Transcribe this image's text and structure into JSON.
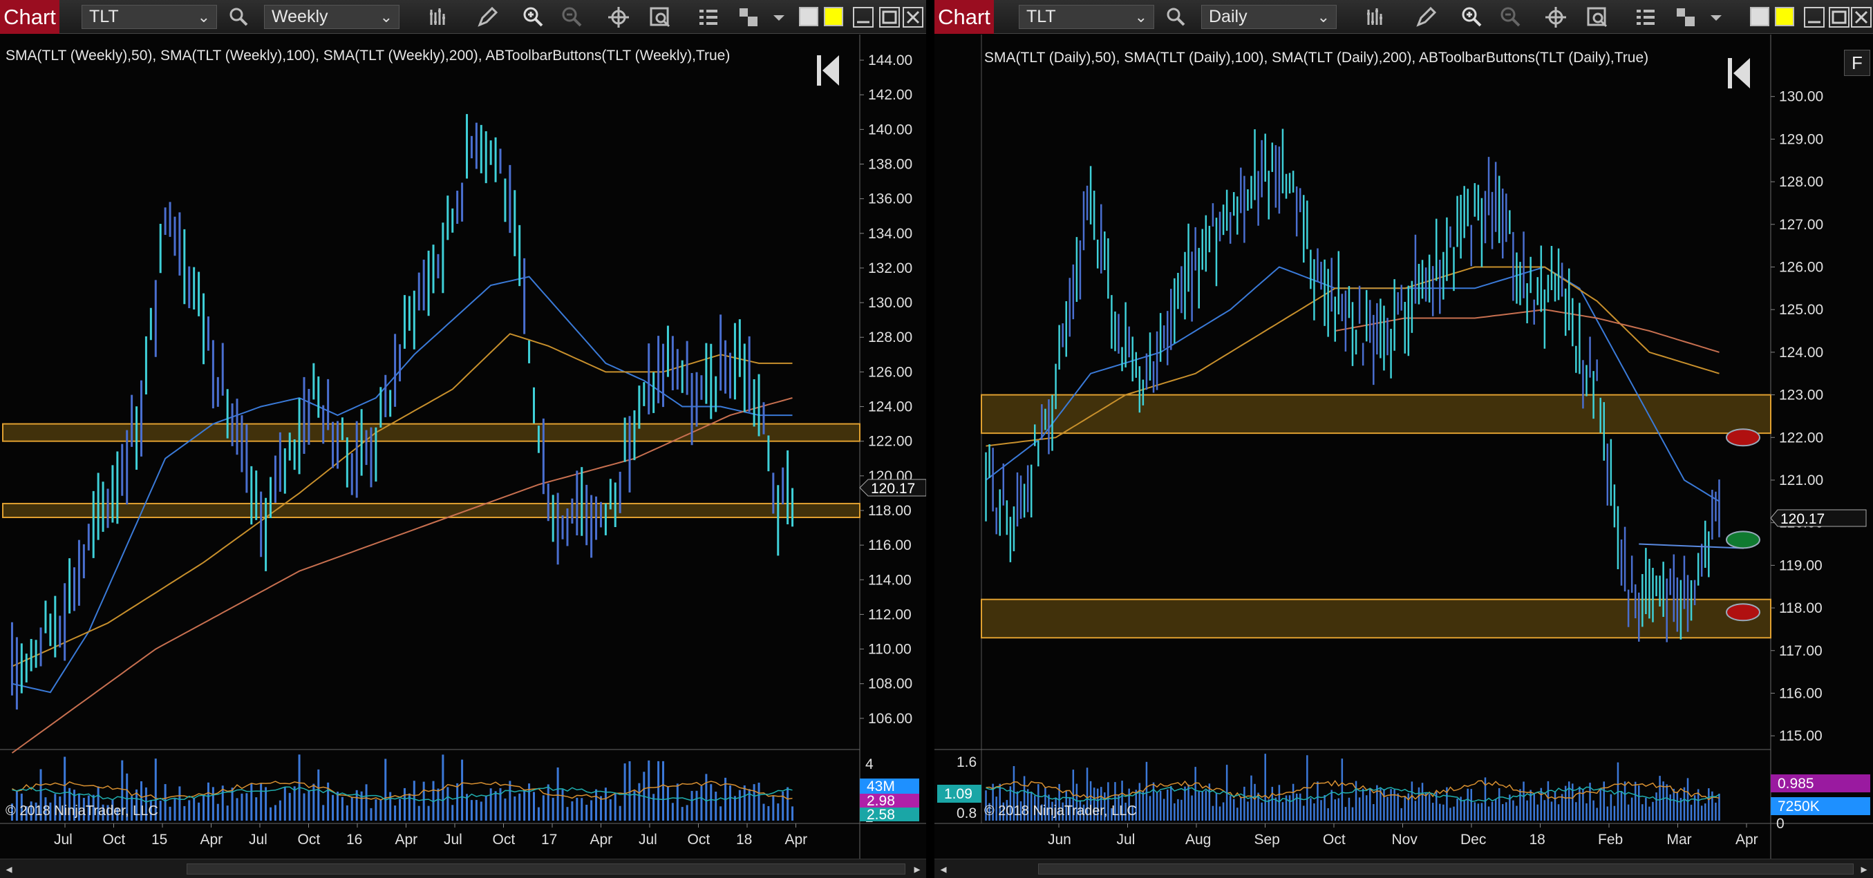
{
  "left": {
    "toolbar": {
      "chart_label": "Chart",
      "instrument": "TLT",
      "interval": "Weekly"
    },
    "indicator_text": "SMA(TLT (Weekly),50), SMA(TLT (Weekly),100), SMA(TLT (Weekly),200), ABToolbarButtons(TLT (Weekly),True)",
    "copyright": "© 2018 NinjaTrader, LLC",
    "last_price": "120.17",
    "volume_labels": [
      "4",
      "2"
    ],
    "volume_badges": [
      {
        "text": "43M",
        "color": "#1e90ff"
      },
      {
        "text": "2.98",
        "color": "#b01fa8"
      },
      {
        "text": "2.58",
        "color": "#1aa6a6"
      }
    ],
    "chart_data": {
      "type": "line",
      "title": "",
      "ylim": [
        104,
        145
      ],
      "yticks": [
        "144.00",
        "142.00",
        "140.00",
        "138.00",
        "136.00",
        "134.00",
        "132.00",
        "130.00",
        "128.00",
        "126.00",
        "124.00",
        "122.00",
        "120.00",
        "118.00",
        "116.00",
        "114.00",
        "112.00",
        "110.00",
        "108.00",
        "106.00"
      ],
      "xticks": [
        "Jul",
        "Oct",
        "15",
        "Apr",
        "Jul",
        "Oct",
        "16",
        "Apr",
        "Jul",
        "Oct",
        "17",
        "Apr",
        "Jul",
        "Oct",
        "18",
        "Apr"
      ],
      "price_series": {
        "name": "TLT Weekly",
        "color": "#3fd0d8",
        "anchors": [
          [
            0,
            108.5
          ],
          [
            10,
            112
          ],
          [
            16,
            116
          ],
          [
            22,
            120
          ],
          [
            27,
            124
          ],
          [
            33,
            136
          ],
          [
            38,
            131
          ],
          [
            42,
            127
          ],
          [
            48,
            121
          ],
          [
            52,
            117
          ],
          [
            56,
            120
          ],
          [
            63,
            125
          ],
          [
            70,
            121
          ],
          [
            76,
            122
          ],
          [
            84,
            130
          ],
          [
            90,
            133
          ],
          [
            97,
            140
          ],
          [
            102,
            138
          ],
          [
            106,
            132
          ],
          [
            110,
            122
          ],
          [
            114,
            117
          ],
          [
            118,
            119
          ],
          [
            123,
            117
          ],
          [
            128,
            121
          ],
          [
            133,
            125
          ],
          [
            138,
            127
          ],
          [
            143,
            124
          ],
          [
            148,
            126
          ],
          [
            152,
            127
          ],
          [
            156,
            124
          ],
          [
            160,
            118
          ],
          [
            163,
            119
          ]
        ]
      },
      "sma_series": [
        {
          "period": 50,
          "color": "#3a7ad8",
          "anchors": [
            [
              0,
              108
            ],
            [
              8,
              107.5
            ],
            [
              16,
              111
            ],
            [
              24,
              116
            ],
            [
              32,
              121
            ],
            [
              42,
              123
            ],
            [
              52,
              124
            ],
            [
              60,
              124.5
            ],
            [
              68,
              123.5
            ],
            [
              76,
              124.5
            ],
            [
              84,
              127
            ],
            [
              92,
              129
            ],
            [
              100,
              131
            ],
            [
              108,
              131.5
            ],
            [
              116,
              129
            ],
            [
              124,
              126.5
            ],
            [
              132,
              125.5
            ],
            [
              140,
              124
            ],
            [
              148,
              124
            ],
            [
              156,
              123.5
            ],
            [
              163,
              123.5
            ]
          ]
        },
        {
          "period": 100,
          "color": "#c8902c",
          "anchors": [
            [
              0,
              109
            ],
            [
              20,
              111.5
            ],
            [
              40,
              115
            ],
            [
              60,
              119
            ],
            [
              76,
              122.5
            ],
            [
              92,
              125
            ],
            [
              104,
              128.2
            ],
            [
              112,
              127.5
            ],
            [
              124,
              126
            ],
            [
              136,
              126
            ],
            [
              148,
              127
            ],
            [
              156,
              126.5
            ],
            [
              163,
              126.5
            ]
          ]
        },
        {
          "period": 200,
          "color": "#c87050",
          "anchors": [
            [
              0,
              104
            ],
            [
              30,
              110
            ],
            [
              60,
              114.5
            ],
            [
              90,
              117.5
            ],
            [
              110,
              119.5
            ],
            [
              130,
              121
            ],
            [
              150,
              123.5
            ],
            [
              163,
              124.5
            ]
          ]
        }
      ],
      "zones": [
        [
          122,
          123
        ],
        [
          117.6,
          118.4
        ]
      ],
      "volume_series": {
        "color": "#3b78d8",
        "count": 164
      }
    }
  },
  "right": {
    "toolbar": {
      "chart_label": "Chart",
      "instrument": "TLT",
      "interval": "Daily"
    },
    "indicator_text": "SMA(TLT (Daily),50), SMA(TLT (Daily),100), SMA(TLT (Daily),200), ABToolbarButtons(TLT (Daily),True)",
    "copyright": "© 2018 NinjaTrader, LLC",
    "last_price": "120.17",
    "f_button": "F",
    "volume_labels": [
      "1.6",
      "0.8",
      "0"
    ],
    "volume_left_badge": "1.09",
    "volume_badges": [
      {
        "text": "0.985",
        "color": "#9a1aa0"
      },
      {
        "text": "7250K",
        "color": "#1e90ff"
      }
    ],
    "chart_data": {
      "type": "line",
      "title": "",
      "ylim": [
        114.5,
        131
      ],
      "yticks": [
        "130.00",
        "129.00",
        "128.00",
        "127.00",
        "126.00",
        "125.00",
        "124.00",
        "123.00",
        "122.00",
        "121.00",
        "120.00",
        "119.00",
        "118.00",
        "117.00",
        "116.00",
        "115.00"
      ],
      "xticks": [
        "Jun",
        "Jul",
        "Aug",
        "Sep",
        "Oct",
        "Nov",
        "Dec",
        "18",
        "Feb",
        "Mar",
        "Apr"
      ],
      "price_series": {
        "name": "TLT Daily",
        "color": "#3fd0d8",
        "anchors": [
          [
            0,
            121
          ],
          [
            8,
            120
          ],
          [
            16,
            122
          ],
          [
            24,
            124.5
          ],
          [
            30,
            127.5
          ],
          [
            36,
            125
          ],
          [
            44,
            123
          ],
          [
            52,
            124.5
          ],
          [
            60,
            126
          ],
          [
            70,
            127.5
          ],
          [
            78,
            128
          ],
          [
            84,
            128.5
          ],
          [
            90,
            127
          ],
          [
            96,
            125.5
          ],
          [
            104,
            125
          ],
          [
            112,
            124
          ],
          [
            116,
            124.5
          ],
          [
            122,
            125.5
          ],
          [
            130,
            126
          ],
          [
            138,
            127
          ],
          [
            146,
            127.5
          ],
          [
            152,
            126
          ],
          [
            158,
            125
          ],
          [
            164,
            126
          ],
          [
            170,
            124
          ],
          [
            176,
            123
          ],
          [
            180,
            120
          ],
          [
            184,
            118.5
          ],
          [
            190,
            118
          ],
          [
            196,
            118.5
          ],
          [
            202,
            118.5
          ],
          [
            206,
            119.5
          ],
          [
            210,
            120.2
          ]
        ]
      },
      "sma_series": [
        {
          "period": 50,
          "color": "#3a7ad8",
          "anchors": [
            [
              0,
              121
            ],
            [
              16,
              122
            ],
            [
              30,
              123.5
            ],
            [
              50,
              124
            ],
            [
              70,
              125
            ],
            [
              84,
              126
            ],
            [
              100,
              125.5
            ],
            [
              120,
              125.5
            ],
            [
              140,
              125.5
            ],
            [
              160,
              126
            ],
            [
              170,
              125.5
            ],
            [
              180,
              124
            ],
            [
              190,
              122.5
            ],
            [
              200,
              121
            ],
            [
              210,
              120.5
            ]
          ]
        },
        {
          "period": 100,
          "color": "#c8902c",
          "anchors": [
            [
              0,
              121.8
            ],
            [
              20,
              122
            ],
            [
              40,
              123
            ],
            [
              60,
              123.5
            ],
            [
              80,
              124.5
            ],
            [
              100,
              125.5
            ],
            [
              120,
              125.5
            ],
            [
              140,
              126
            ],
            [
              160,
              126
            ],
            [
              175,
              125.2
            ],
            [
              190,
              124
            ],
            [
              210,
              123.5
            ]
          ]
        },
        {
          "period": 200,
          "color": "#c87050",
          "anchors": [
            [
              100,
              124.5
            ],
            [
              120,
              124.8
            ],
            [
              140,
              124.8
            ],
            [
              160,
              125
            ],
            [
              175,
              124.8
            ],
            [
              190,
              124.5
            ],
            [
              210,
              124
            ]
          ]
        }
      ],
      "zones": [
        [
          122.1,
          123
        ],
        [
          117.3,
          118.2
        ]
      ],
      "markers": [
        {
          "value": 122.0,
          "color": "#b01010"
        },
        {
          "value": 119.6,
          "color": "#107a30"
        },
        {
          "value": 117.9,
          "color": "#b01010"
        }
      ],
      "trendline": [
        [
          187,
          119.5
        ],
        [
          217,
          119.4
        ]
      ],
      "volume_series": {
        "color": "#3b78d8",
        "count": 211
      }
    }
  }
}
